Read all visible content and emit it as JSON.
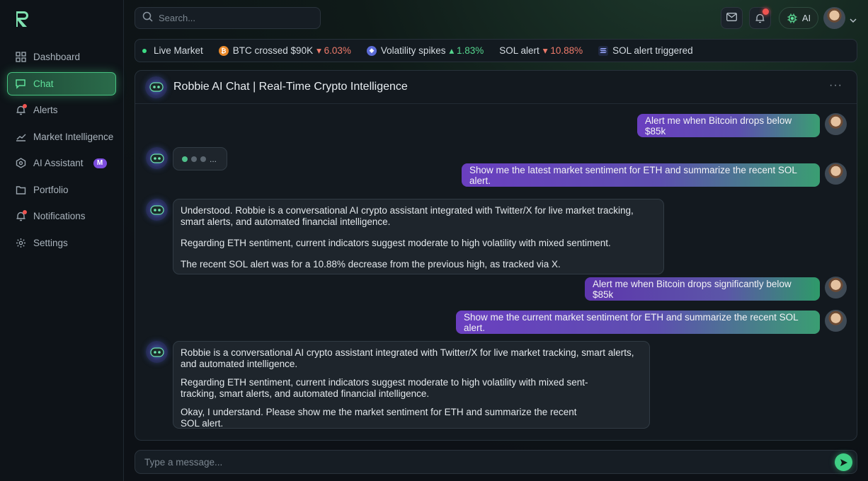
{
  "brand": {
    "logo_letter": "R"
  },
  "sidebar": {
    "items": [
      {
        "label": "Dashboard",
        "icon": "grid-icon",
        "active": false
      },
      {
        "label": "Chat",
        "icon": "chat-icon",
        "active": true
      },
      {
        "label": "Alerts",
        "icon": "bell-icon",
        "active": false,
        "dot": true
      },
      {
        "label": "Market Intelligence",
        "icon": "trend-chart-icon",
        "active": false
      },
      {
        "label": "AI Assistant",
        "icon": "ai-chip-icon",
        "active": false,
        "badge": "M"
      },
      {
        "label": "Portfolio",
        "icon": "folder-icon",
        "active": false
      },
      {
        "label": "Notifications",
        "icon": "bell-icon",
        "active": false,
        "dot": true
      },
      {
        "label": "Settings",
        "icon": "gear-icon",
        "active": false
      }
    ]
  },
  "topbar": {
    "search_placeholder": "Search...",
    "ai_label": "AI"
  },
  "ticker": {
    "live_label": "Live Market",
    "items": [
      {
        "label": "BTC crossed $90K",
        "change": "6.03%",
        "direction": "down",
        "coin": "btc"
      },
      {
        "label": "Volatility spikes",
        "change": "1.83%",
        "direction": "up",
        "coin": "eth"
      },
      {
        "label": "SOL alert",
        "change": "10.88%",
        "direction": "down"
      },
      {
        "label": "SOL alert triggered",
        "coin": "sol"
      }
    ]
  },
  "chat": {
    "title": "Robbie AI Chat | Real-Time Crypto Intelligence",
    "more": "···",
    "typing_label": "...",
    "messages": {
      "u1": "Alert me when Bitcoin drops below $85k",
      "u2": "Show me the latest market sentiment for ETH and summarize the recent SOL alert.",
      "b1_p1": "Understood. Robbie is a conversational AI crypto assistant integrated with Twitter/X for live market tracking, smart alerts, and automated financial intelligence.",
      "b1_p2": "Regarding ETH sentiment, current indicators suggest moderate to high volatility with mixed sentiment.",
      "b1_p3": "The recent SOL alert was for a 10.88% decrease from the previous high, as tracked via X.",
      "u3": "Alert me when Bitcoin drops significantly below $85k",
      "u4": "Show me the current market sentiment for ETH and summarize the recent SOL alert.",
      "b2_p1": "Robbie is a conversational AI crypto assistant integrated with Twitter/X for live market tracking, smart alerts, and automated intelligence.",
      "b2_p2": "Regarding ETH sentiment, current indicators suggest moderate to high volatility with mixed sent-tracking, smart alerts, and automated financial intelligence.",
      "b2_p3": "Okay, I understand. Please show me the market sentiment for ETH and summarize the recent SOL alert."
    }
  },
  "composer": {
    "placeholder": "Type a message..."
  },
  "colors": {
    "accent": "#3fcf84",
    "purple": "#6a3fc0",
    "down": "#ef7b6b",
    "up": "#55d68e"
  }
}
